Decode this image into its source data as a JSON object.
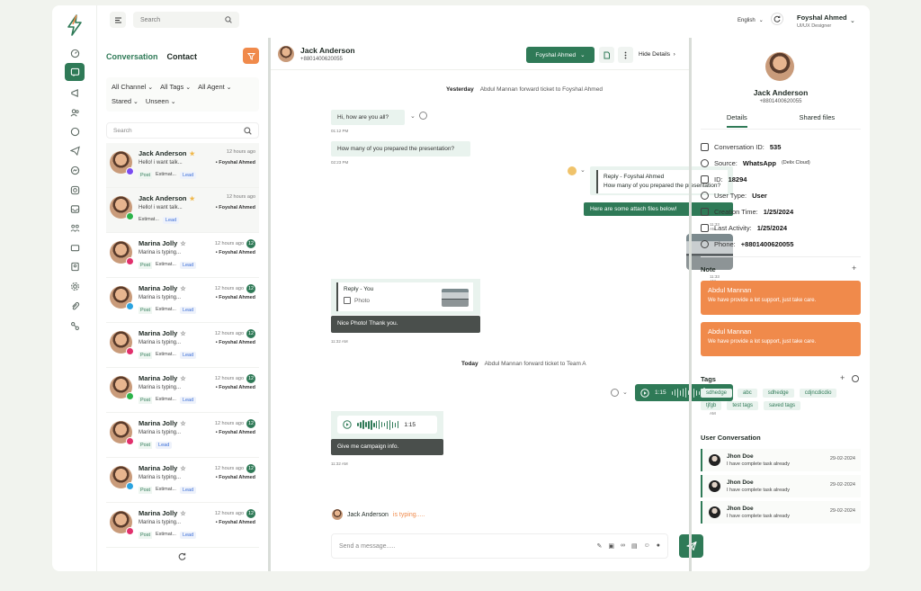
{
  "topbar": {
    "search_placeholder": "Search",
    "language": "English",
    "user_name": "Foyshal Ahmed",
    "user_role": "UI/UX Designer"
  },
  "conversations_panel": {
    "tabs": [
      "Conversation",
      "Contact"
    ],
    "filters": [
      "All Channel",
      "All Tags",
      "All Agent",
      "Stared",
      "Unseen"
    ],
    "search_placeholder": "Search",
    "items": [
      {
        "name": "Jack Anderson",
        "time": "12 hours ago",
        "message": "Hello! i want talk...",
        "agent": "Foyshal Ahmed",
        "tags": [
          "Post",
          "Estimat...",
          "Lead"
        ],
        "channel": "messenger",
        "starred": true
      },
      {
        "name": "Jack Anderson",
        "time": "12 hours ago",
        "message": "Hello! i want talk...",
        "agent": "Foyshal Ahmed",
        "tags": [
          "Estimat...",
          "Lead"
        ],
        "channel": "whatsapp",
        "starred": true
      },
      {
        "name": "Marina Jolly",
        "time": "12 hours ago",
        "unread": "12",
        "message": "Marina is typing...",
        "agent": "Foyshal Ahmed",
        "tags": [
          "Post",
          "Estimat...",
          "Lead"
        ],
        "channel": "instagram"
      },
      {
        "name": "Marina Jolly",
        "time": "12 hours ago",
        "unread": "12",
        "message": "Marina is typing...",
        "agent": "Foyshal Ahmed",
        "tags": [
          "Post",
          "Estimat...",
          "Lead"
        ],
        "channel": "telegram"
      },
      {
        "name": "Marina Jolly",
        "time": "12 hours ago",
        "unread": "12",
        "message": "Marina is typing...",
        "agent": "Foyshal Ahmed",
        "tags": [
          "Post",
          "Estimat...",
          "Lead"
        ],
        "channel": "instagram"
      },
      {
        "name": "Marina Jolly",
        "time": "12 hours ago",
        "unread": "12",
        "message": "Marina is typing...",
        "agent": "Foyshal Ahmed",
        "tags": [
          "Post",
          "Estimat...",
          "Lead"
        ],
        "channel": "whatsapp"
      },
      {
        "name": "Marina Jolly",
        "time": "12 hours ago",
        "unread": "12",
        "message": "Marina is typing...",
        "agent": "Foyshal Ahmed",
        "tags": [
          "Post",
          "Lead"
        ],
        "channel": "instagram"
      },
      {
        "name": "Marina Jolly",
        "time": "12 hours ago",
        "unread": "12",
        "message": "Marina is typing...",
        "agent": "Foyshal Ahmed",
        "tags": [
          "Post",
          "Estimat...",
          "Lead"
        ],
        "channel": "telegram"
      },
      {
        "name": "Marina Jolly",
        "time": "12 hours ago",
        "unread": "12",
        "message": "Marina is typing...",
        "agent": "Foyshal Ahmed",
        "tags": [
          "Post",
          "Estimat...",
          "Lead"
        ],
        "channel": "instagram"
      }
    ]
  },
  "chat": {
    "contact_name": "Jack Anderson",
    "contact_phone": "+8801400620055",
    "assign_label": "Foyshal Ahmed",
    "hide_details": "Hide Details",
    "day1": "Yesterday",
    "event1": "Abdul Mannan forward ticket to Foyshal Ahmed",
    "msg1": "Hi, how are you all?",
    "msg1_time": "01:12 PM",
    "msg2": "How many of you prepared the presentation?",
    "msg2_time": "02:23 PM",
    "reply_title": "Reply - Foyshal Ahmed",
    "reply_text": "How many of you prepared the presentation?",
    "msg3": "Here are some attach files below!",
    "msg3_time": "11:33 AM",
    "img_time": "11:33 AM",
    "reply2_title": "Reply - You",
    "reply2_text": "Photo",
    "msg4": "Nice Photo! Thank you.",
    "msg4_time": "11:32 AM",
    "day2": "Today",
    "event2": "Abdul Mannan forward ticket to Team A",
    "voice_out_duration": "1:15",
    "voice_out_time": "11:33 AM",
    "voice_in_duration": "1:15",
    "msg5": "Give me campaign info.",
    "msg5_time": "11:32 AM",
    "typing_name": "Jack Anderson",
    "typing_text": "is typing.....",
    "composer_placeholder": "Send a message....."
  },
  "details": {
    "name": "Jack Anderson",
    "phone": "+8801400620055",
    "tabs": [
      "Details",
      "Shared files"
    ],
    "conversation_id_label": "Conversation ID:",
    "conversation_id": "535",
    "source_label": "Source:",
    "source": "WhatsApp",
    "source_note": "(Delix Cloud)",
    "id_label": "ID:",
    "id": "18294",
    "user_type_label": "User Type:",
    "user_type": "User",
    "creation_label": "Creation Time:",
    "creation": "1/25/2024",
    "activity_label": "Last Activity:",
    "activity": "1/25/2024",
    "phone_label": "Phone:",
    "phone_value": "+8801400620055",
    "note_title": "Note",
    "notes": [
      {
        "author": "Abdul Mannan",
        "text": "We have provide a lot support, just take care."
      },
      {
        "author": "Abdul Mannan",
        "text": "We have provide a lot support, just take care."
      }
    ],
    "tags_title": "Tags",
    "tags": [
      "sdhedge",
      "abc",
      "sdhedge",
      "cdjncdicdio",
      "tjfgb",
      "test tags",
      "saved tags"
    ],
    "user_conversation_title": "User Conversation",
    "user_conversations": [
      {
        "name": "Jhon Doe",
        "message": "I have complete task already",
        "date": "29-02-2024"
      },
      {
        "name": "Jhon Doe",
        "message": "I have complete task already",
        "date": "29-02-2024"
      },
      {
        "name": "Jhon Doe",
        "message": "I have complete task already",
        "date": "29-02-2024"
      }
    ]
  },
  "colors": {
    "primary": "#2f7a57",
    "accent": "#f08a4b",
    "bubble_in": "#e9f3ee",
    "bubble_dark": "#4a4f4c"
  },
  "channel_colors": {
    "messenger": "#7a4cf0",
    "whatsapp": "#2bb34a",
    "instagram": "#e1306c",
    "telegram": "#2aa3e0"
  }
}
